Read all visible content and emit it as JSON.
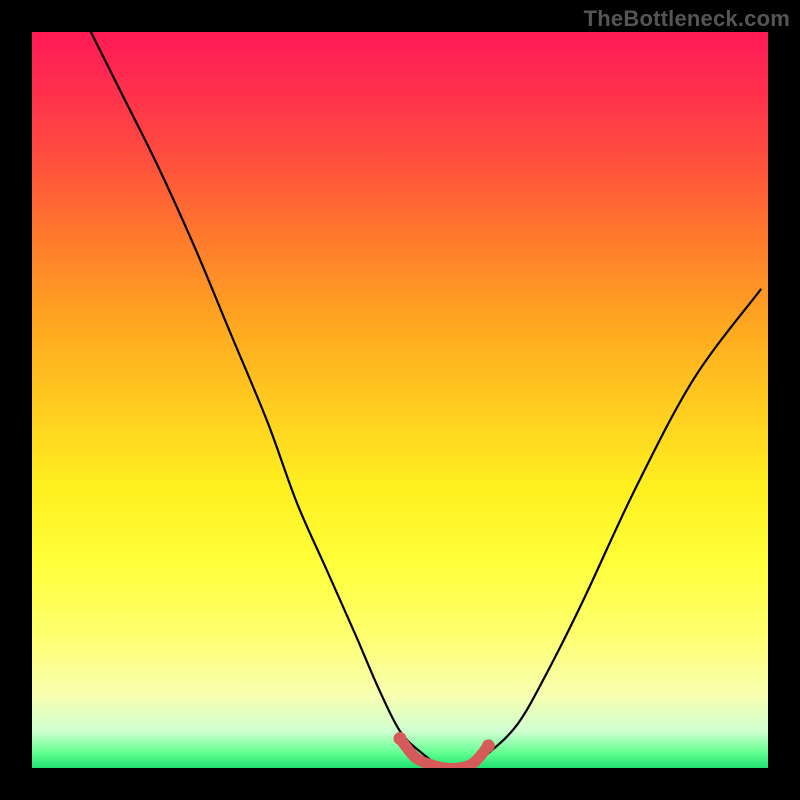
{
  "watermark": "TheBottleneck.com",
  "chart_data": {
    "type": "line",
    "title": "",
    "xlabel": "",
    "ylabel": "",
    "xlim": [
      0,
      100
    ],
    "ylim": [
      0,
      100
    ],
    "grid": false,
    "series": [
      {
        "name": "curve",
        "color": "#000000",
        "x": [
          8,
          12,
          17,
          22,
          27,
          32,
          36,
          40,
          44,
          47,
          50,
          53,
          56,
          59,
          62,
          66,
          70,
          75,
          82,
          90,
          99
        ],
        "y": [
          100,
          92,
          82,
          71,
          59,
          47,
          36,
          27,
          18,
          11,
          5,
          2,
          0,
          0,
          2,
          6,
          13,
          23,
          38,
          53,
          65
        ]
      },
      {
        "name": "valley-marker",
        "color": "#d65a5a",
        "x": [
          50,
          52,
          54,
          56,
          58,
          60,
          62
        ],
        "y": [
          4,
          1.5,
          0.5,
          0,
          0,
          0.7,
          3
        ]
      }
    ],
    "background_gradient_stops": [
      {
        "pos": 0,
        "color": "#ff1a55"
      },
      {
        "pos": 16,
        "color": "#ff4a40"
      },
      {
        "pos": 40,
        "color": "#ffa820"
      },
      {
        "pos": 62,
        "color": "#fff020"
      },
      {
        "pos": 82,
        "color": "#ffff70"
      },
      {
        "pos": 95,
        "color": "#d0ffd0"
      },
      {
        "pos": 100,
        "color": "#20e070"
      }
    ]
  }
}
